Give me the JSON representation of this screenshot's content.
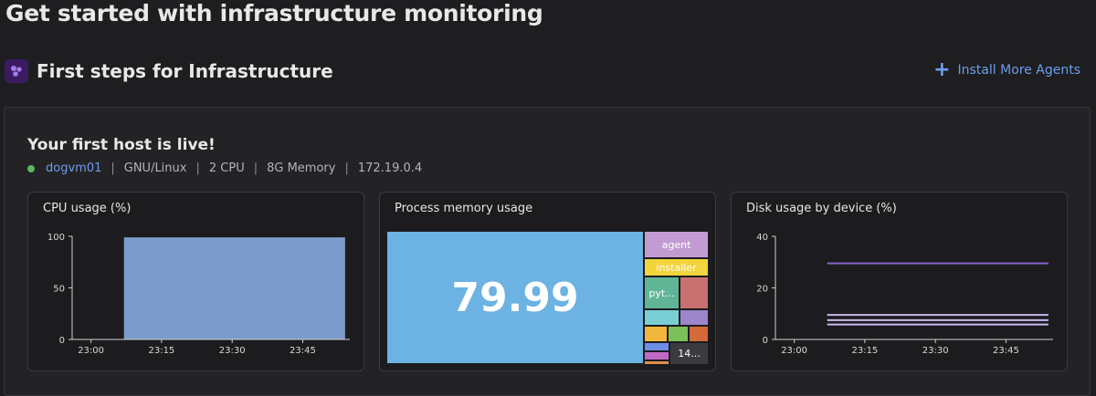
{
  "header": {
    "title": "Get started with infrastructure monitoring"
  },
  "section": {
    "title": "First steps for Infrastructure",
    "icon": "hexagon-nodes-icon",
    "install_label": "Install More Agents"
  },
  "host": {
    "title": "Your first host is live!",
    "name": "dogvm01",
    "os": "GNU/Linux",
    "cpu": "2 CPU",
    "memory": "8G Memory",
    "ip": "172.19.0.4",
    "status_color": "#5cb85c"
  },
  "widgets": {
    "cpu": {
      "title": "CPU usage (%)"
    },
    "memory": {
      "title": "Process memory usage"
    },
    "disk": {
      "title": "Disk usage by device (%)"
    }
  },
  "chart_data": [
    {
      "type": "area",
      "title": "CPU usage (%)",
      "x_ticks": [
        "23:00",
        "23:15",
        "23:30",
        "23:45"
      ],
      "y_ticks": [
        "0",
        "50",
        "100"
      ],
      "ylim": [
        0,
        100
      ],
      "x": [
        "23:07",
        "23:15",
        "23:30",
        "23:45",
        "23:54"
      ],
      "values": [
        99,
        99,
        99,
        99,
        99
      ],
      "color": "#7b9ccb"
    },
    {
      "type": "treemap",
      "title": "Process memory usage",
      "big_value": "79.99",
      "cells": [
        {
          "label": "agent",
          "color": "#c39bd3"
        },
        {
          "label": "installer",
          "color": "#f2d43d"
        },
        {
          "label": "pyt...",
          "color": "#5fb596"
        },
        {
          "label": "",
          "color": "#c97070"
        },
        {
          "label": "",
          "color": "#79cfd4"
        },
        {
          "label": "",
          "color": "#9c86c9"
        },
        {
          "label": "",
          "color": "#f2b63d"
        },
        {
          "label": "",
          "color": "#7cc05a"
        },
        {
          "label": "",
          "color": "#d46a3a"
        },
        {
          "label": "",
          "color": "#6e8ee8"
        },
        {
          "label": "",
          "color": "#c068c6"
        },
        {
          "label": "",
          "color": "#e1904a"
        },
        {
          "label": "14...",
          "color": "#3b3b3f"
        }
      ],
      "main_color": "#6cb2e2"
    },
    {
      "type": "line",
      "title": "Disk usage by device (%)",
      "x_ticks": [
        "23:00",
        "23:15",
        "23:30",
        "23:45"
      ],
      "y_ticks": [
        "0",
        "20",
        "40"
      ],
      "ylim": [
        0,
        40
      ],
      "x_range": [
        "23:07",
        "23:54"
      ],
      "series": [
        {
          "value": 29.5,
          "color": "#8b63c9"
        },
        {
          "value": 9.5,
          "color": "#c9b8f0"
        },
        {
          "value": 7.5,
          "color": "#c9b8f0"
        },
        {
          "value": 5.8,
          "color": "#c9b8f0"
        }
      ]
    }
  ]
}
